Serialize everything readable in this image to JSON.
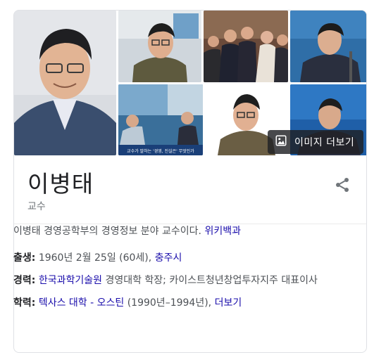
{
  "images": {
    "more_label": "이미지 더보기",
    "thumbnails": [
      {
        "icon": "person-photo-main"
      },
      {
        "icon": "person-photo-office"
      },
      {
        "icon": "group-photo-event"
      },
      {
        "icon": "person-photo-podium"
      },
      {
        "icon": "person-photo-tv-interview"
      },
      {
        "icon": "person-photo-portrait"
      },
      {
        "icon": "person-photo-stage"
      }
    ],
    "tv_caption": "교수가 말하는 '경영, 진실은' 무엇인가"
  },
  "header": {
    "title": "이병태",
    "subtitle": "교수"
  },
  "description": {
    "text": "이병태 경영공학부의 경영정보 분야 교수이다.",
    "source_link": "위키백과"
  },
  "facts": {
    "birth": {
      "label": "출생:",
      "text": "1960년 2월 25일 (60세),",
      "link": "충주시"
    },
    "career": {
      "label": "경력:",
      "link": "한국과학기술원",
      "text": "경영대학 학장; 카이스트청년창업투자지주 대표이사"
    },
    "education": {
      "label": "학력:",
      "link": "텍사스 대학 - 오스틴",
      "text": "(1990년–1994년),",
      "more_link": "더보기"
    }
  },
  "colors": {
    "link": "#1a0dab",
    "text": "#4d5156",
    "title": "#202124"
  }
}
